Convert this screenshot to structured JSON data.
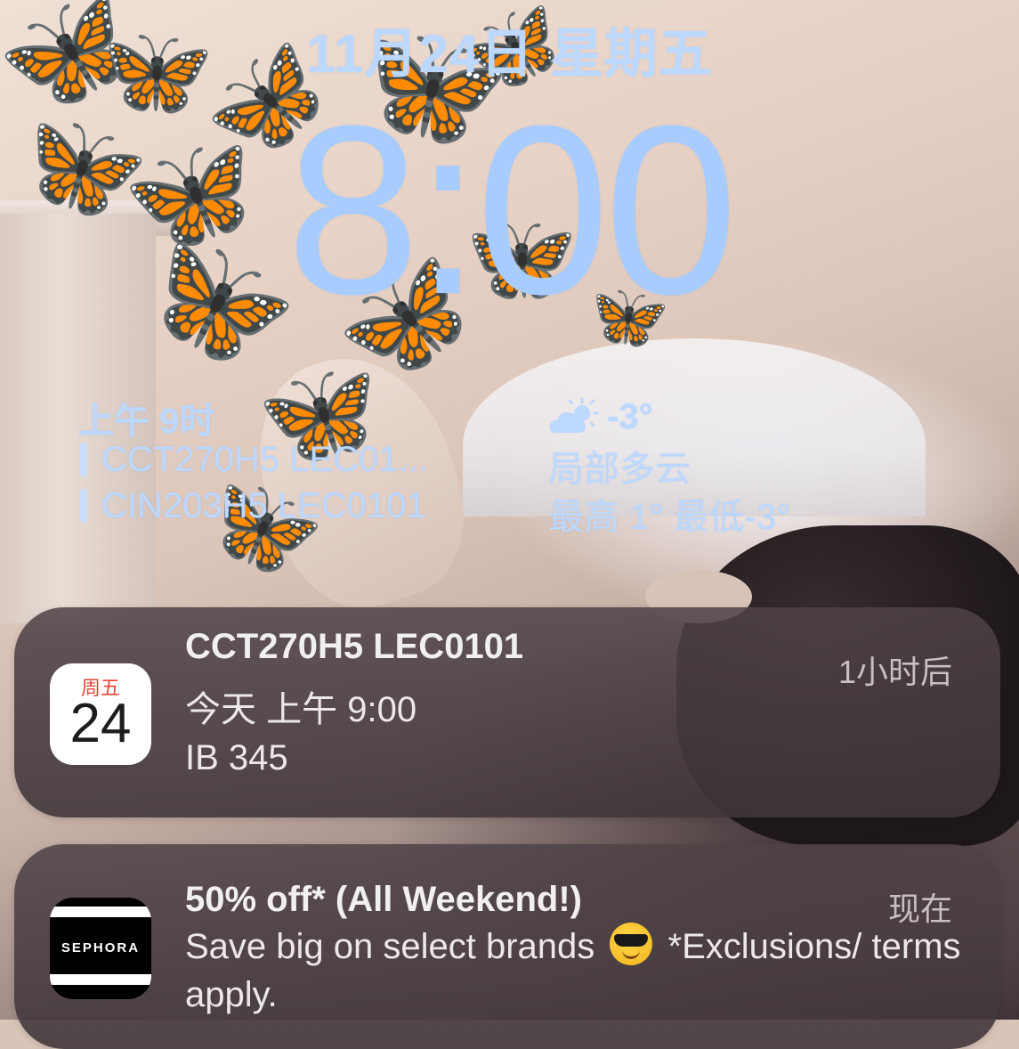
{
  "lock_screen": {
    "date": "11月24日 星期五",
    "time": "8:00"
  },
  "calendar_widget": {
    "title": "上午 9时",
    "events": [
      "CCT270H5 LEC01...",
      "CIN203H5 LEC0101"
    ]
  },
  "weather_widget": {
    "icon": "partly-cloudy-icon",
    "temperature": "-3°",
    "condition": "局部多云",
    "high_low": "最高 1° 最低-3°"
  },
  "notifications": [
    {
      "app_icon": "calendar-app-icon",
      "icon_day": "周五",
      "icon_date": "24",
      "title": "CCT270H5 LEC0101",
      "lines": [
        "今天 上午 9:00",
        "IB 345"
      ],
      "time": "1小时后"
    },
    {
      "app_icon": "sephora-app-icon",
      "icon_text": "SEPHORA",
      "title": "50% off* (All Weekend!)",
      "body_before": "Save big on select brands",
      "emoji": "sunglasses-emoji",
      "body_after": "*Exclusions/ terms apply.",
      "time": "现在"
    }
  ],
  "colors": {
    "clock": "#a9ccff",
    "widget_text": "#bcd8ff",
    "notification_bg": "#4e4246",
    "calendar_red": "#e5463b"
  }
}
